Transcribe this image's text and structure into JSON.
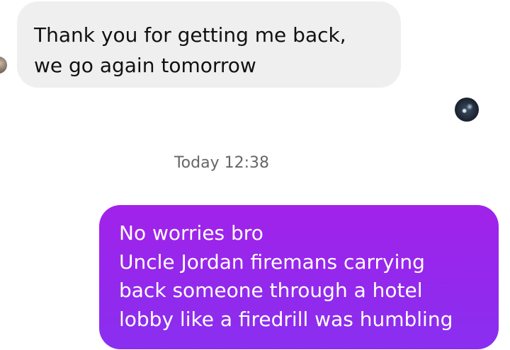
{
  "received_message": {
    "lines": [
      "Thank you for getting me back,",
      "we go again tomorrow"
    ]
  },
  "timestamp": "Today 12:38",
  "sent_message": {
    "lines": [
      "No worries bro",
      "Uncle Jordan firemans carrying",
      "back someone through a hotel",
      "lobby like a firedrill was humbling"
    ]
  },
  "colors": {
    "received_bubble": "#efefef",
    "sent_bubble_top": "#a222ea",
    "sent_bubble_bottom": "#8a2ff0",
    "timestamp_text": "#666666"
  }
}
